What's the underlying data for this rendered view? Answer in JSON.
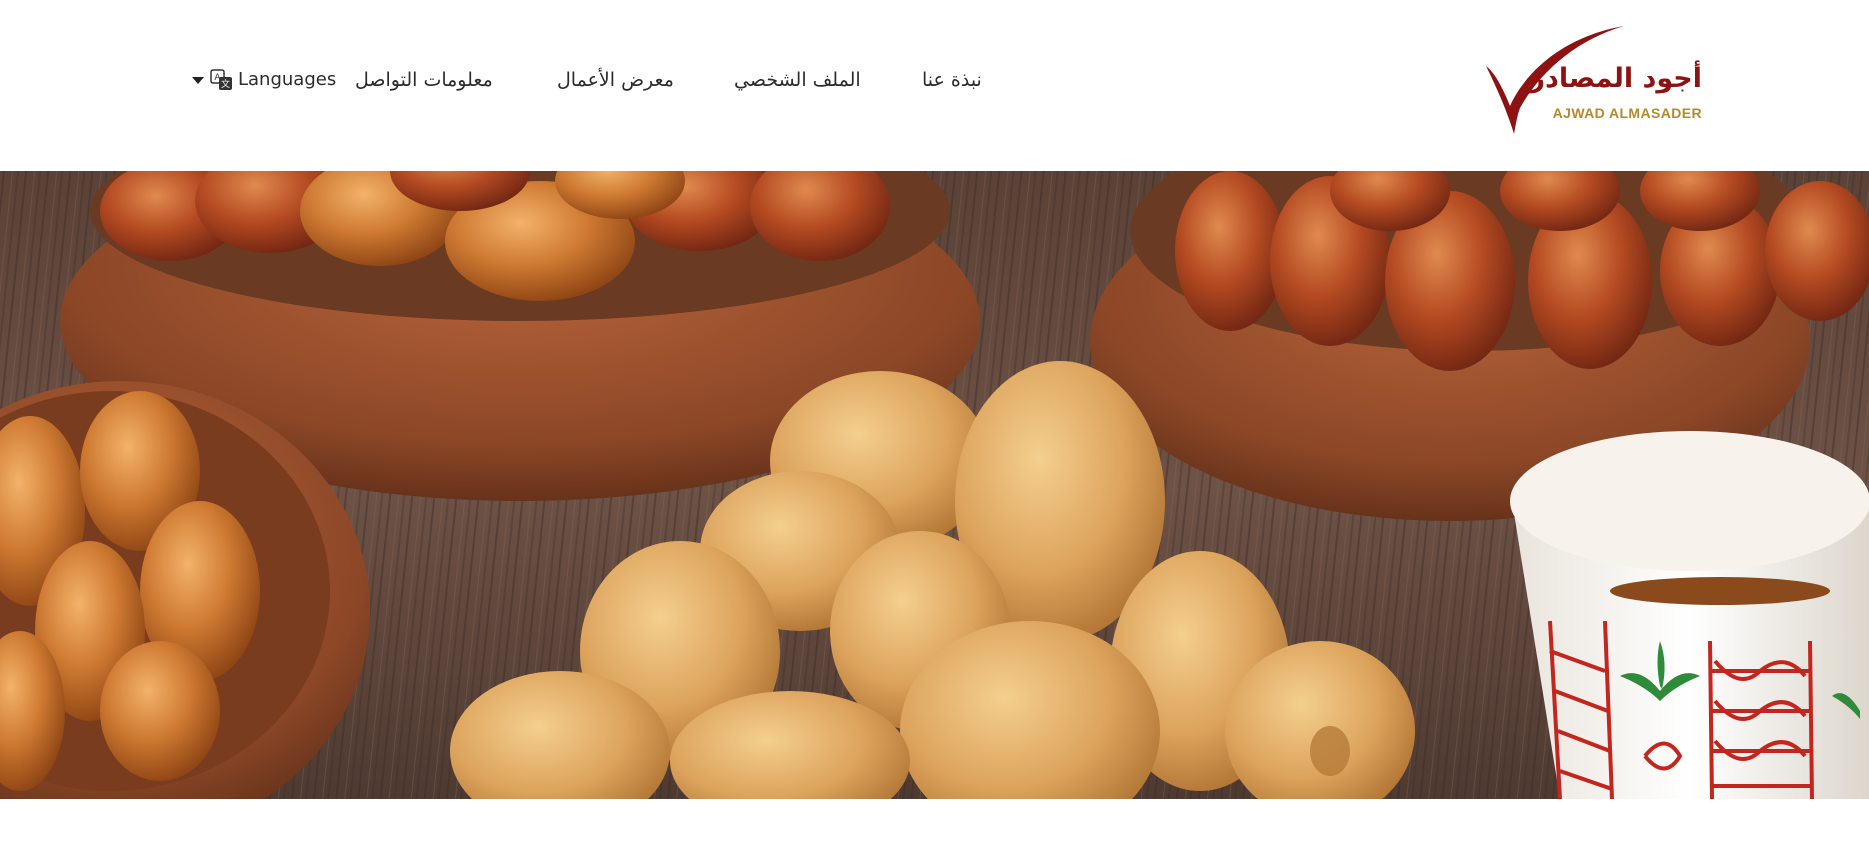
{
  "header": {
    "logo": {
      "arabic_name": "أجود المصادر",
      "english_name": "AJWAD ALMASADER",
      "mark": "checkmark-logo",
      "colors": {
        "red": "#8e1212",
        "gold": "#b48a2a"
      }
    },
    "nav": {
      "items": [
        {
          "label": "نبذة عنا"
        },
        {
          "label": "الملف الشخصي"
        },
        {
          "label": "معرض الأعمال"
        },
        {
          "label": "معلومات التواصل"
        }
      ],
      "languages_label": "Languages",
      "languages_icon": "translate-icon",
      "languages_caret": "caret-down-icon"
    }
  },
  "hero": {
    "image": "dates-and-arabic-coffee-photo",
    "subject": [
      "bowl-of-dates-top-left",
      "bowl-of-dates-top-right",
      "bowl-of-dates-left",
      "pile-of-dates-center",
      "arabic-coffee-cup-right"
    ]
  }
}
